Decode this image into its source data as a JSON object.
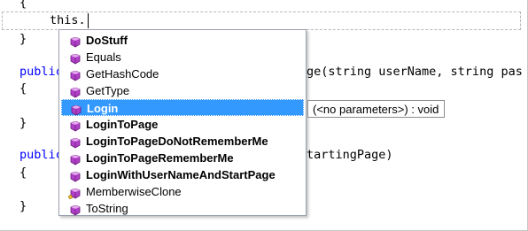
{
  "editor": {
    "lines": {
      "l0": "{",
      "l1": "this.",
      "l2": "}",
      "l3_kw": "public",
      "l3_tail": "ge(string userName, string pas",
      "l4": "{",
      "l5": "}",
      "l6_kw": "public",
      "l6_tail": "tartingPage)",
      "l7": "{",
      "l8": "}"
    }
  },
  "intellisense": {
    "items": [
      {
        "label": "DoStuff",
        "bold": true,
        "icon": "method-icon"
      },
      {
        "label": "Equals",
        "bold": false,
        "icon": "method-icon"
      },
      {
        "label": "GetHashCode",
        "bold": false,
        "icon": "method-icon"
      },
      {
        "label": "GetType",
        "bold": false,
        "icon": "method-icon"
      },
      {
        "label": "Login",
        "bold": true,
        "icon": "method-icon",
        "selected": true
      },
      {
        "label": "LoginToPage",
        "bold": true,
        "icon": "method-icon"
      },
      {
        "label": "LoginToPageDoNotRememberMe",
        "bold": true,
        "icon": "method-icon"
      },
      {
        "label": "LoginToPageRememberMe",
        "bold": true,
        "icon": "method-icon"
      },
      {
        "label": "LoginWithUserNameAndStartPage",
        "bold": true,
        "icon": "method-icon"
      },
      {
        "label": "MemberwiseClone",
        "bold": false,
        "icon": "protected-method-icon"
      },
      {
        "label": "ToString",
        "bold": false,
        "icon": "method-icon"
      }
    ]
  },
  "tooltip": {
    "text": "(<no parameters>) : void"
  },
  "colors": {
    "keyword": "#0000ff",
    "selection": "#3399ff",
    "method_icon": "#b040c8"
  }
}
